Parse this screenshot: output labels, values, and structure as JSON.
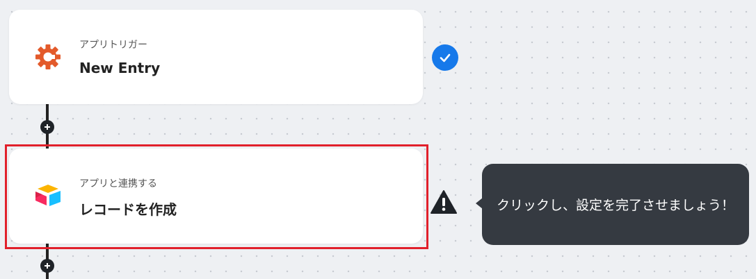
{
  "flow": {
    "steps": [
      {
        "subtitle": "アプリトリガー",
        "title": "New Entry",
        "icon": "cognito-forms-gear-icon",
        "status_icon": "check-circle-icon",
        "status_color": "#1679ea"
      },
      {
        "subtitle": "アプリと連携する",
        "title": "レコードを作成",
        "icon": "airtable-logo-icon",
        "status_icon": "warning-triangle-icon",
        "highlight_color": "#e1202b"
      }
    ],
    "add_icon": "plus-icon"
  },
  "tooltip": {
    "text": "クリックし、設定を完了させましょう！"
  },
  "colors": {
    "app_icon_orange": "#e35a2b",
    "tooltip_bg": "#353a41",
    "canvas_bg": "#eef0f3"
  }
}
